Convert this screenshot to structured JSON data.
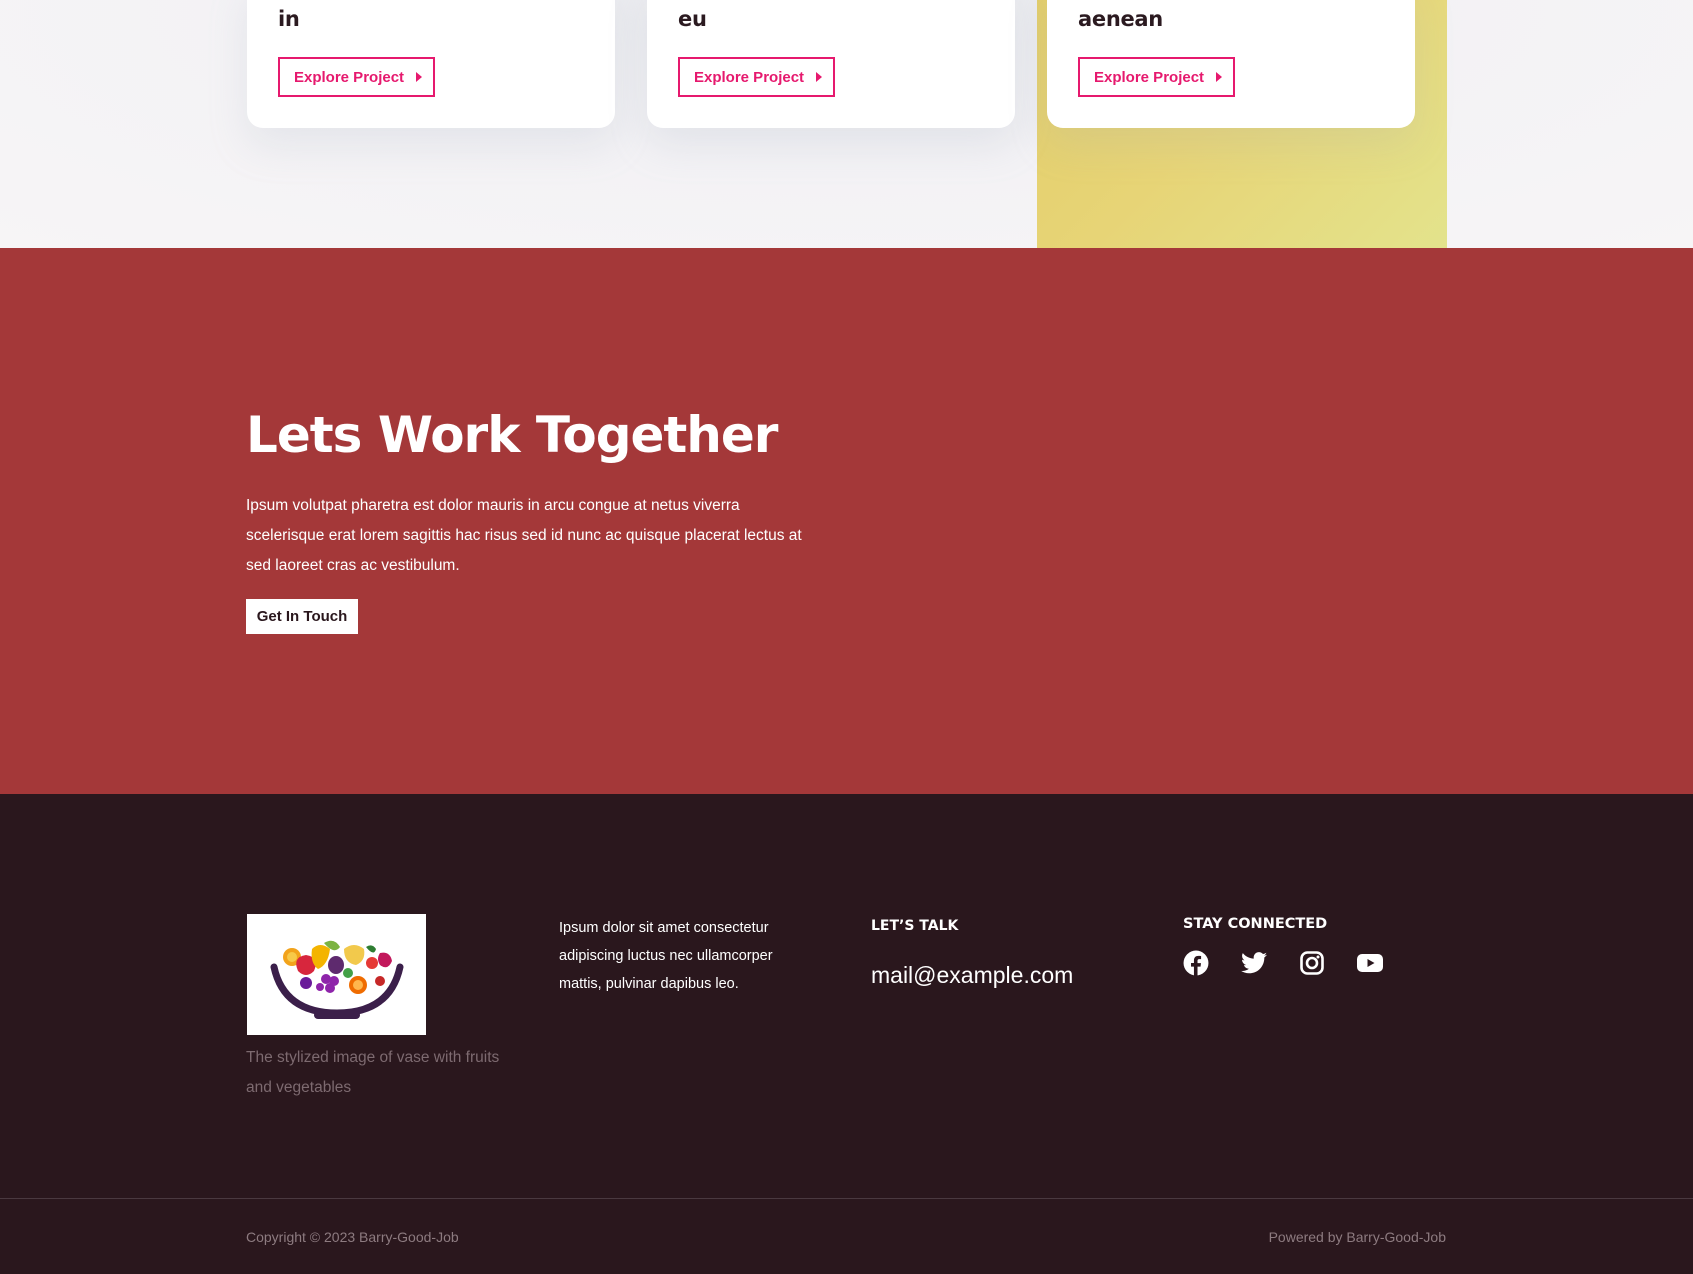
{
  "projects": {
    "cards": [
      {
        "title_tail": "in",
        "button_label": "Explore Project"
      },
      {
        "title_tail": "eu",
        "button_label": "Explore Project"
      },
      {
        "title_tail": "aenean",
        "button_label": "Explore Project"
      }
    ]
  },
  "cta": {
    "title": "Lets Work Together",
    "text": "Ipsum volutpat pharetra est dolor mauris in arcu congue at netus viverra scelerisque erat lorem sagittis hac risus sed id nunc ac quisque placerat lectus at sed laoreet cras ac vestibulum.",
    "button_label": "Get In Touch"
  },
  "footer": {
    "logo_caption": "The stylized image of vase with fruits and vegetables",
    "about_text": "Ipsum dolor sit amet consectetur adipiscing luctus nec ullamcorper mattis, pulvinar dapibus leo.",
    "talk_heading": "LET’S TALK",
    "email": "mail@example.com",
    "stay_heading": "STAY CONNECTED",
    "social_icons": [
      "facebook-icon",
      "twitter-icon",
      "instagram-icon",
      "youtube-icon"
    ],
    "copyright": "Copyright © 2023 Barry-Good-Job",
    "powered_by": "Powered by Barry-Good-Job"
  },
  "colors": {
    "accent_pink": "#e6196e",
    "cta_red": "#a43839",
    "footer_dark": "#2a171d",
    "yellow_panel": "#e5d475"
  }
}
